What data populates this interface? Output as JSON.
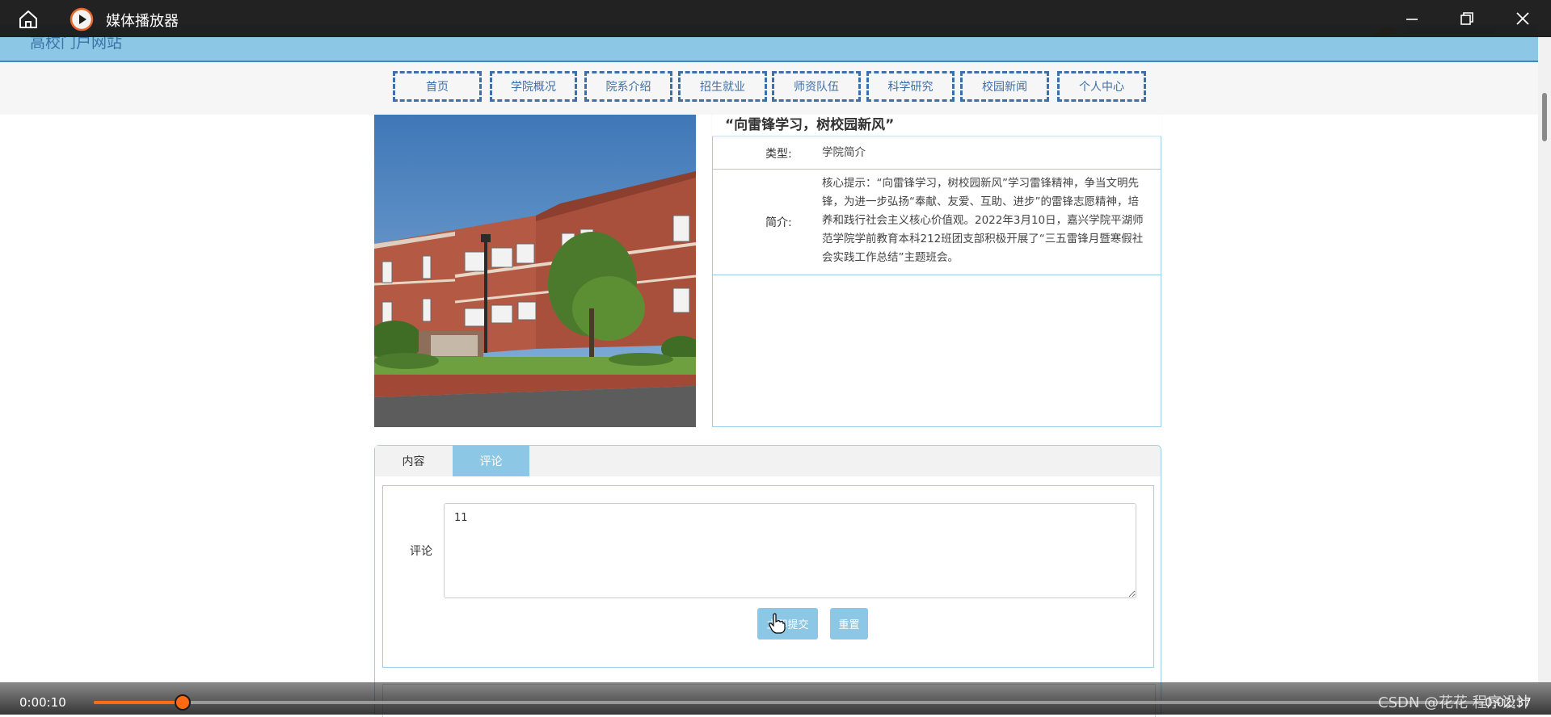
{
  "player": {
    "title": "媒体播放器",
    "time_current": "0:00:10",
    "time_total": "0:02:37",
    "progress": 0.064
  },
  "site": {
    "name": "高校门户网站"
  },
  "nav": {
    "items": [
      "首页",
      "学院概况",
      "院系介绍",
      "招生就业",
      "师资队伍",
      "科学研究",
      "校园新闻",
      "个人中心"
    ]
  },
  "article": {
    "title": "“向雷锋学习，树校园新风”",
    "type_label": "类型:",
    "type_value": "学院简介",
    "summary_label": "简介:",
    "summary_text": "核心提示：“向雷锋学习，树校园新风”学习雷锋精神，争当文明先锋，为进一步弘扬“奉献、友爱、互助、进步”的雷锋志愿精神，培养和践行社会主义核心价值观。2022年3月10日，嘉兴学院平湖师范学院学前教育本科212班团支部积极开展了“三五雷锋月暨寒假社会实践工作总结”主题班会。"
  },
  "tabs": {
    "content": "内容",
    "comment": "评论"
  },
  "comment_form": {
    "label": "评论",
    "value": "11",
    "submit_label": "立即提交",
    "reset_label": "重置"
  },
  "watermark": "CSDN @花花 程序设计"
}
